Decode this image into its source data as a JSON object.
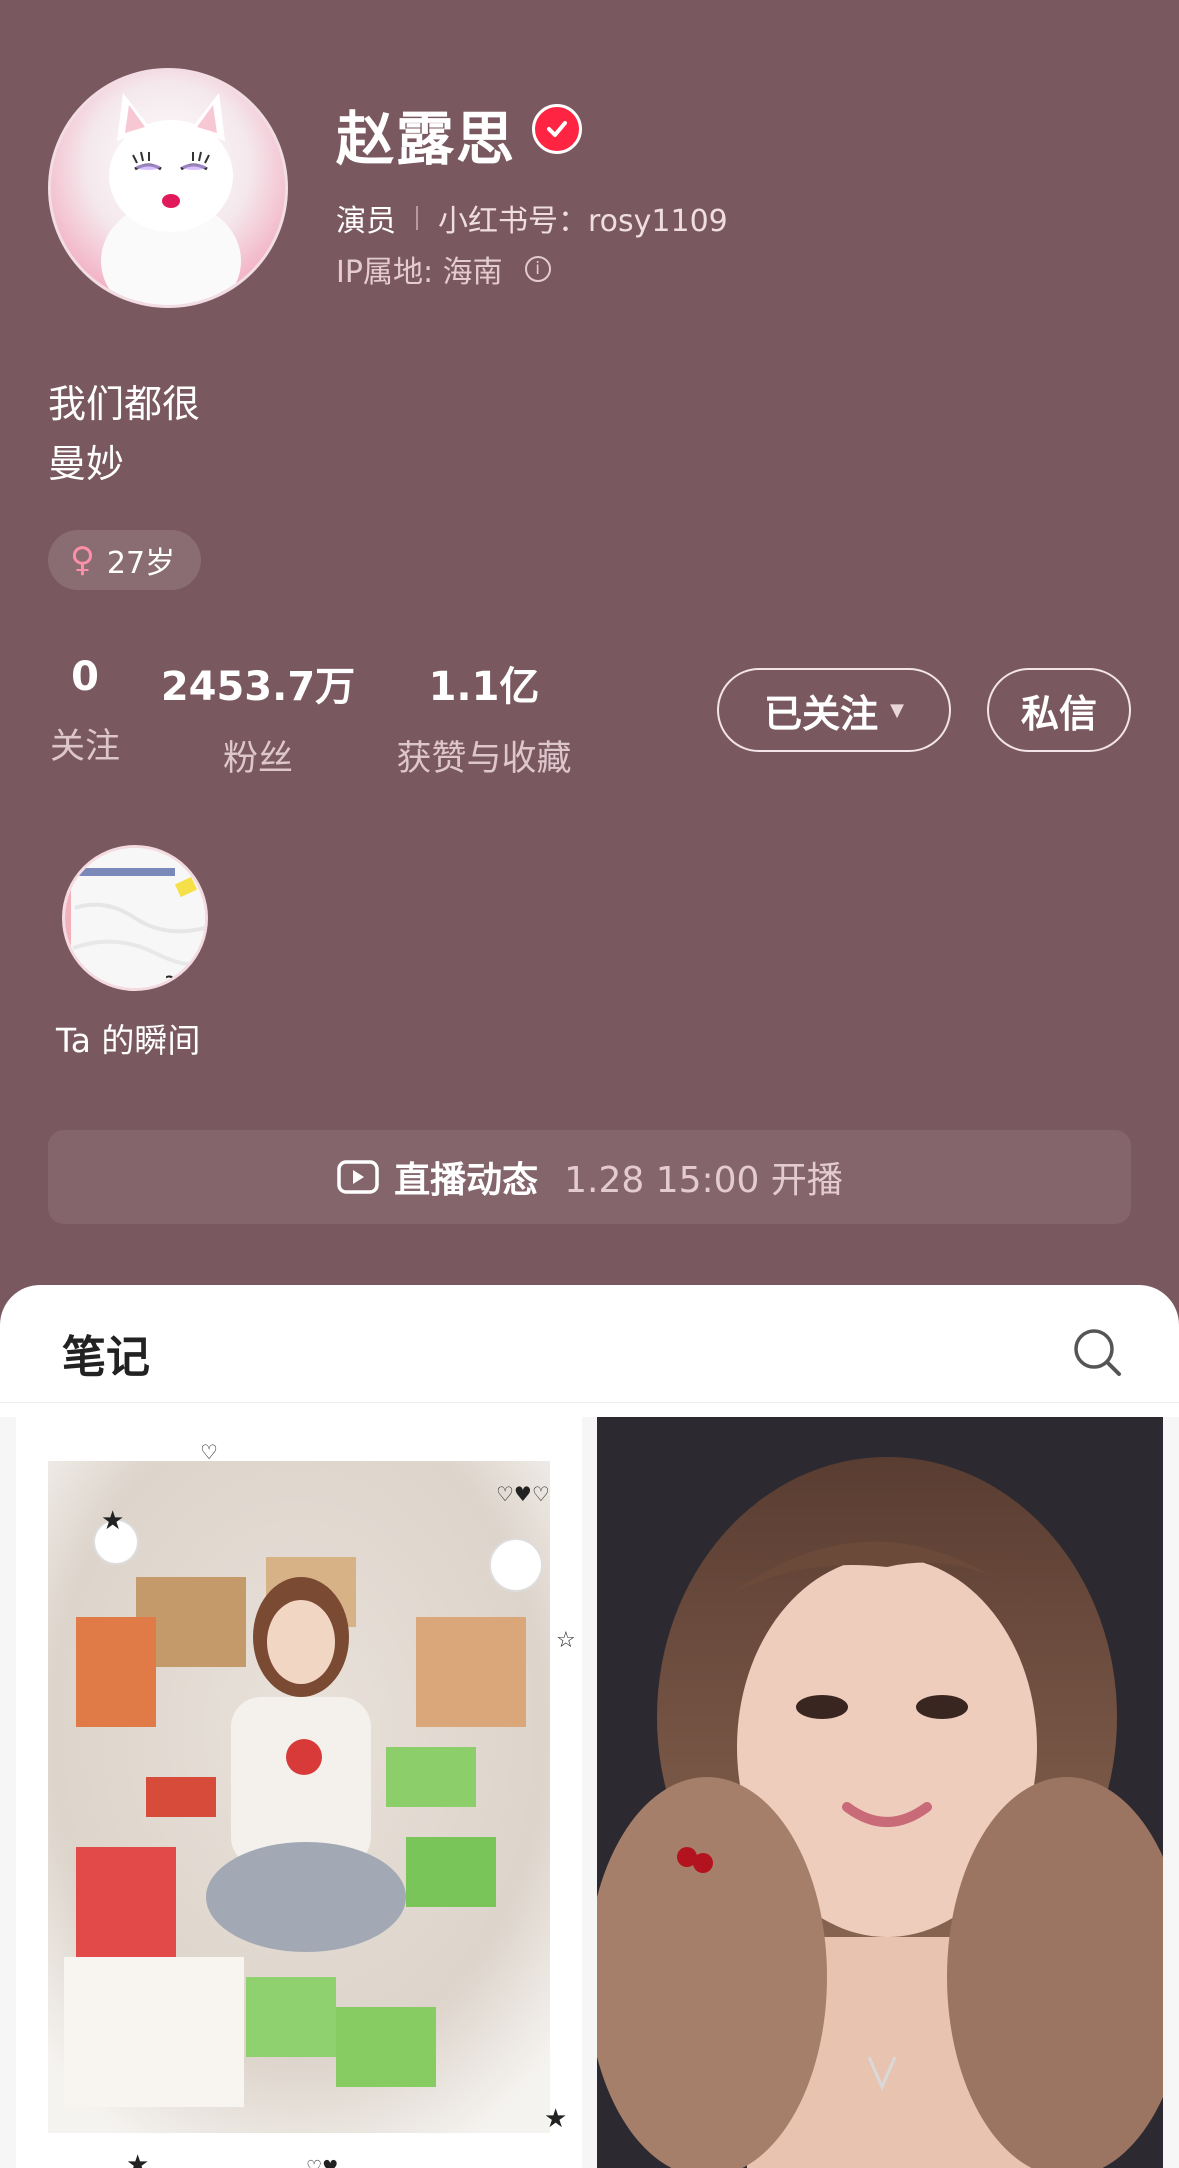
{
  "profile": {
    "name": "赵露思",
    "role": "演员",
    "id_label": "小红书号：rosy1109",
    "ip_label": "IP属地: 海南",
    "bio_line1": "我们都很",
    "bio_line2": "曼妙",
    "gender_symbol": "♀",
    "age": "27岁",
    "verified_color": "#ff2442",
    "background_color": "#7a5860"
  },
  "stats": [
    {
      "value": "0",
      "label": "关注"
    },
    {
      "value": "2453.7万",
      "label": "粉丝"
    },
    {
      "value": "1.1亿",
      "label": "获赞与收藏"
    }
  ],
  "actions": {
    "follow_label": "已关注",
    "message_label": "私信"
  },
  "moments": {
    "label": "Ta 的瞬间"
  },
  "live": {
    "title": "直播动态",
    "time": "1.28 15:00 开播"
  },
  "tabs": {
    "notes": "笔记"
  },
  "icons": {
    "verified": "check-badge-icon",
    "info": "info-circle-icon",
    "gender": "female-icon",
    "follow_caret": "caret-down-icon",
    "live": "video-camera-icon",
    "search": "search-icon"
  }
}
